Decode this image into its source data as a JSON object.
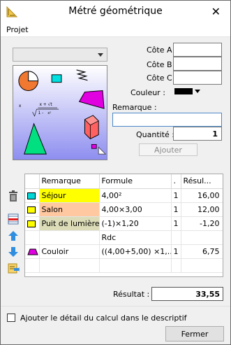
{
  "window": {
    "title": "Métré géométrique",
    "close_glyph": "✕"
  },
  "menu": {
    "items": [
      "Projet"
    ]
  },
  "form": {
    "shape_select_value": "",
    "cote_a_label": "Côte A",
    "cote_b_label": "Côte B",
    "cote_c_label": "Côte C",
    "cote_a_value": "",
    "cote_b_value": "",
    "cote_c_value": "",
    "couleur_label": "Couleur :",
    "couleur_value": "#000000",
    "remarque_label": "Remarque :",
    "remarque_value": "",
    "quantite_label": "Quantité :",
    "quantite_value": "1",
    "ajouter_label": "Ajouter"
  },
  "preview": {
    "formula_top": "x + √t",
    "formula_bottom": "x²",
    "formula_root": "1 - ",
    "formula_x": "x"
  },
  "table": {
    "headers": [
      "Remarque",
      "Formule",
      ".",
      "Résul..."
    ],
    "rows": [
      {
        "shape": "square",
        "color": "#00d8d8",
        "remark": "Séjour",
        "remark_bg": "#ffff00",
        "formula": "4,00²",
        "qty": "1",
        "result": "16,00"
      },
      {
        "shape": "rect",
        "color": "#ffff00",
        "remark": "Salon",
        "remark_bg": "#ffc8a0",
        "formula": "4,00×3,00",
        "qty": "1",
        "result": "12,00"
      },
      {
        "shape": "rect",
        "color": "#ffff00",
        "remark": "Puit de lumière",
        "remark_bg": "#dcdcb8",
        "formula": "(-1)×1,20",
        "qty": "1",
        "result": "-1,20"
      },
      {
        "shape": "none",
        "color": "",
        "remark": "",
        "remark_bg": "",
        "formula": "Rdc",
        "qty": "",
        "result": ""
      },
      {
        "shape": "trapezoid",
        "color": "#e000e0",
        "remark": "Couloir",
        "remark_bg": "",
        "formula": "((4,00+5,00) ×1,...",
        "qty": "1",
        "result": "6,75"
      }
    ]
  },
  "side_icons": [
    "trash-icon",
    "insert-row-icon",
    "move-up-icon",
    "move-down-icon",
    "export-icon"
  ],
  "resultat": {
    "label": "Résultat :",
    "value": "33,55"
  },
  "detail_checkbox": {
    "label": "Ajouter le détail du calcul dans le descriptif",
    "checked": false
  },
  "fermer_label": "Fermer"
}
